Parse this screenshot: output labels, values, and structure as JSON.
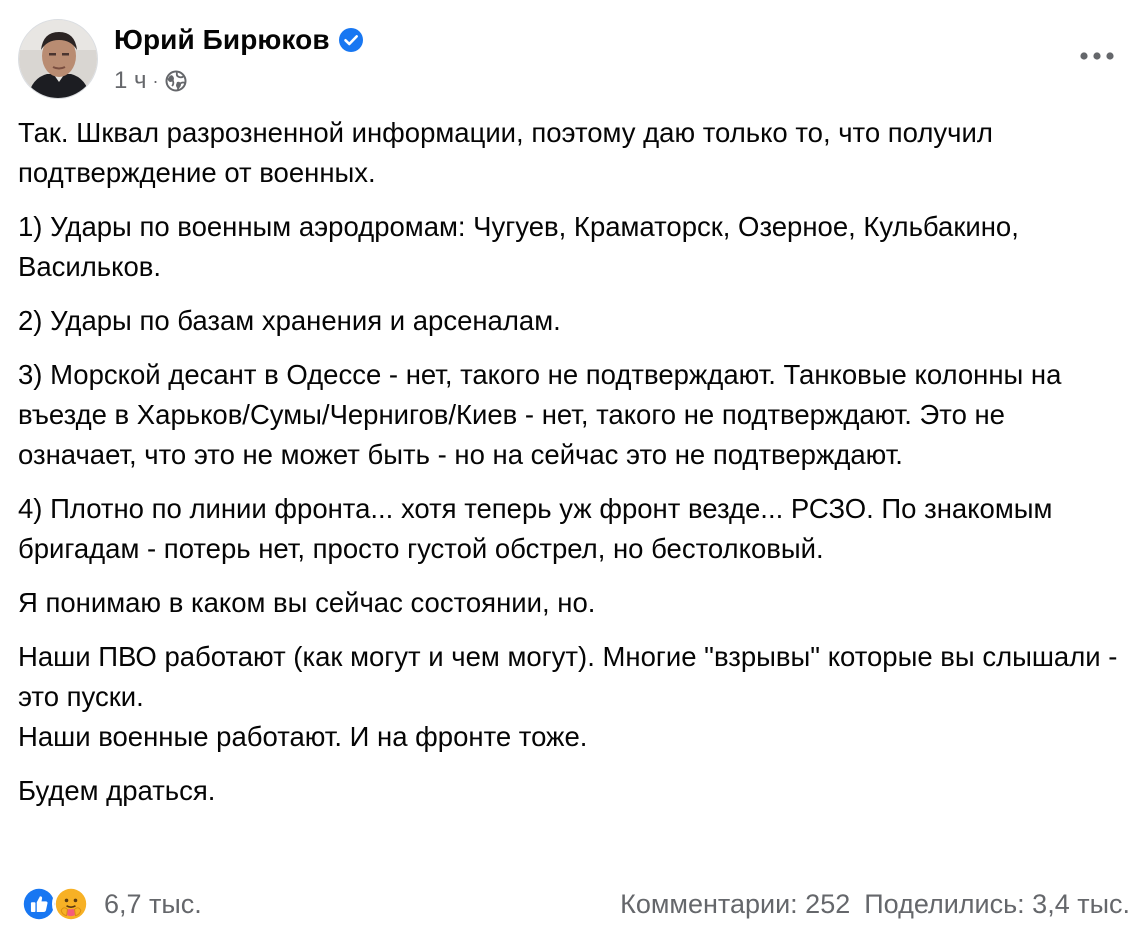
{
  "post": {
    "author": "Юрий Бирюков",
    "time": "1 ч",
    "separator": "·",
    "visibility_icon": "globe-icon",
    "verified_icon": "verified-badge-icon",
    "more_icon": "more-options-icon",
    "paragraphs": [
      "Так. Шквал разрозненной информации, поэтому даю только то, что получил подтверждение от военных.",
      "1) Удары по военным аэродромам: Чугуев, Краматорск, Озерное, Кульбакино, Васильков.",
      "2) Удары по базам хранения и арсеналам.",
      "3) Морской десант в Одессе - нет, такого не подтверждают. Танковые колонны на въезде в Харьков/Сумы/Чернигов/Киев - нет, такого не подтверждают. Это не означает, что это не может быть - но на сейчас это не подтверждают.",
      "4) Плотно по линии фронта... хотя теперь уж фронт везде... РСЗО. По знакомым бригадам - потерь нет,  просто густой обстрел, но бестолковый.",
      "Я понимаю в каком вы сейчас состоянии, но.",
      "Наши ПВО работают (как могут и чем могут). Многие \"взрывы\" которые вы слышали - это пуски.\nНаши военные работают. И на фронте тоже.",
      "Будем драться."
    ]
  },
  "footer": {
    "reactions": [
      "like-reaction-icon",
      "care-reaction-icon"
    ],
    "reaction_count": "6,7 тыс.",
    "comments": "Комментарии: 252",
    "shares": "Поделились: 3,4 тыс."
  },
  "colors": {
    "accent": "#1877f2",
    "secondary_text": "#65676b",
    "primary_text": "#050505",
    "care_yellow": "#f7b125"
  }
}
